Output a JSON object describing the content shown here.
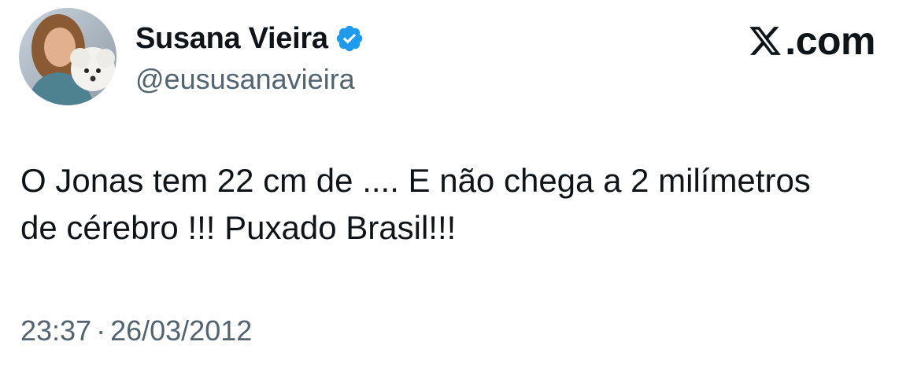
{
  "author": {
    "display_name": "Susana Vieira",
    "handle": "@eususanavieira",
    "verified": true,
    "verified_color": "#1d9bf0",
    "avatar_icon": "profile-photo-woman-with-white-dog"
  },
  "brand": {
    "logo_icon": "x-logo-icon",
    "text": ".com"
  },
  "tweet": {
    "text_lines": [
      "O Jonas tem 22 cm de .... E não chega a 2 milímetros",
      "de cérebro !!! Puxado Brasil!!!"
    ]
  },
  "meta": {
    "time": "23:37",
    "separator": "·",
    "date": "26/03/2012"
  },
  "colors": {
    "text": "#0f1419",
    "secondary": "#536471",
    "background": "#ffffff"
  }
}
